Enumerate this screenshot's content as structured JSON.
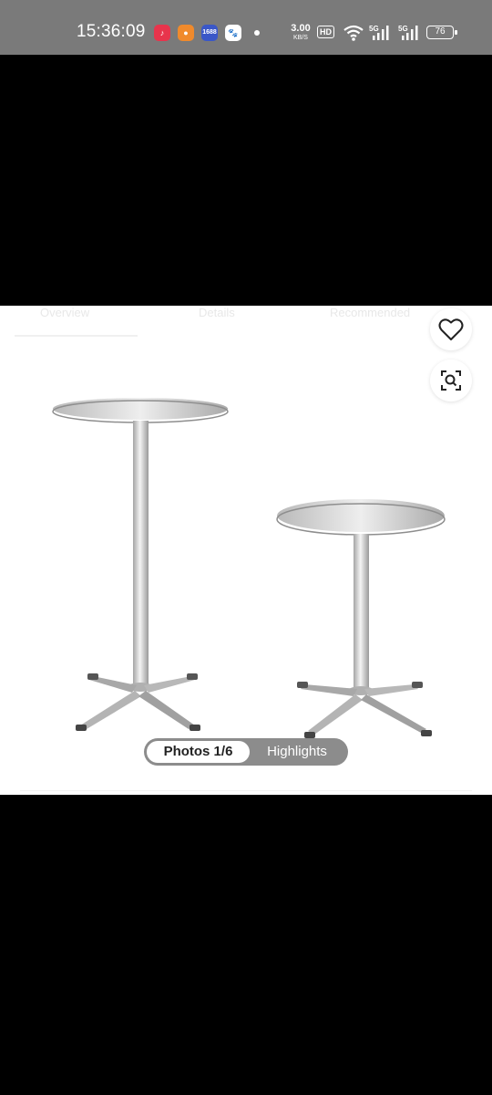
{
  "status_bar": {
    "time": "15:36:09",
    "app_icons": [
      "music-app-icon",
      "orange-app-icon",
      "1688-app-icon",
      "baidu-app-icon"
    ],
    "app_icon_labels": {
      "alibaba": "1688"
    },
    "net_speed_value": "3.00",
    "net_speed_unit": "KB/S",
    "hd_label": "HD",
    "signal_1_label": "5G",
    "signal_2_label": "5G",
    "battery_level": "76"
  },
  "product": {
    "tabs": [
      "Overview",
      "Details",
      "Recommended"
    ],
    "photos_label": "Photos 1/6",
    "highlights_label": "Highlights",
    "favorite_icon": "heart-icon",
    "image_search_icon": "image-search-icon"
  },
  "colors": {
    "status_bar_bg": "#7a7a7a",
    "panel_bg": "#ffffff",
    "toggle_bg": "#8c8c8c"
  }
}
